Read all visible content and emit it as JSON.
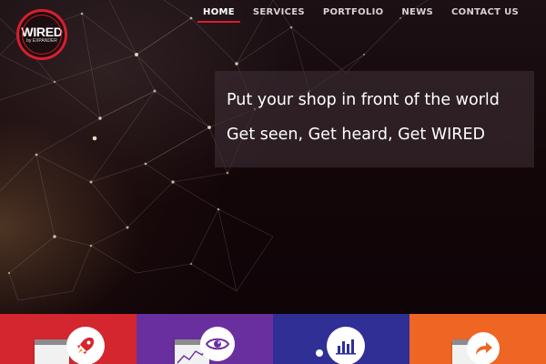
{
  "brand": {
    "logo_main": "WIRED",
    "logo_sub": "by EXPANDER"
  },
  "nav": {
    "items": [
      {
        "label": "HOME",
        "active": true
      },
      {
        "label": "SERVICES",
        "active": false
      },
      {
        "label": "PORTFOLIO",
        "active": false
      },
      {
        "label": "NEWS",
        "active": false
      },
      {
        "label": "CONTACT US",
        "active": false
      }
    ]
  },
  "hero": {
    "line1": "Put your shop in front of the world",
    "line2": "Get seen, Get heard, Get WIRED"
  },
  "features": [
    {
      "color": "#d3262f",
      "icon": "rocket-icon"
    },
    {
      "color": "#6a2f9e",
      "icon": "eye-icon"
    },
    {
      "color": "#2f2f96",
      "icon": "bar-chart-icon"
    },
    {
      "color": "#ef6524",
      "icon": "share-icon"
    }
  ],
  "colors": {
    "accent": "#d81f2e"
  }
}
